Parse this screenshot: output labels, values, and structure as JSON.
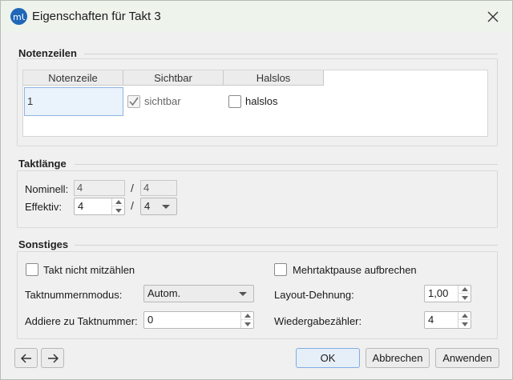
{
  "window": {
    "title": "Eigenschaften für Takt 3"
  },
  "icons": {
    "app": "musescore-icon",
    "close": "close-icon",
    "prev": "arrow-left-icon",
    "next": "arrow-right-icon"
  },
  "notenzeilen": {
    "section_title": "Notenzeilen",
    "columns": [
      "Notenzeile",
      "Sichtbar",
      "Halslos"
    ],
    "rows": [
      {
        "staff": "1",
        "visible_label": "sichtbar",
        "visible_checked": true,
        "stemless_label": "halslos",
        "stemless_checked": false
      }
    ]
  },
  "taktlaenge": {
    "section_title": "Taktlänge",
    "nominal_label": "Nominell:",
    "nominal_numerator": "4",
    "nominal_denominator": "4",
    "actual_label": "Effektiv:",
    "actual_numerator": "4",
    "actual_denominator": "4",
    "separator": "/"
  },
  "sonstiges": {
    "section_title": "Sonstiges",
    "exclude_count_label": "Takt nicht mitzählen",
    "exclude_count_checked": false,
    "break_mmrest_label": "Mehrtaktpause aufbrechen",
    "break_mmrest_checked": false,
    "number_mode_label": "Taktnummernmodus:",
    "number_mode_value": "Autom.",
    "layout_stretch_label": "Layout-Dehnung:",
    "layout_stretch_value": "1,00",
    "add_to_number_label": "Addiere zu Taktnummer:",
    "add_to_number_value": "0",
    "play_count_label": "Wiedergabezähler:",
    "play_count_value": "4"
  },
  "buttons": {
    "ok": "OK",
    "cancel": "Abbrechen",
    "apply": "Anwenden"
  },
  "colors": {
    "accent": "#1f67b8",
    "titlebar": "#eef3ec",
    "selection": "#8fb5e2"
  }
}
